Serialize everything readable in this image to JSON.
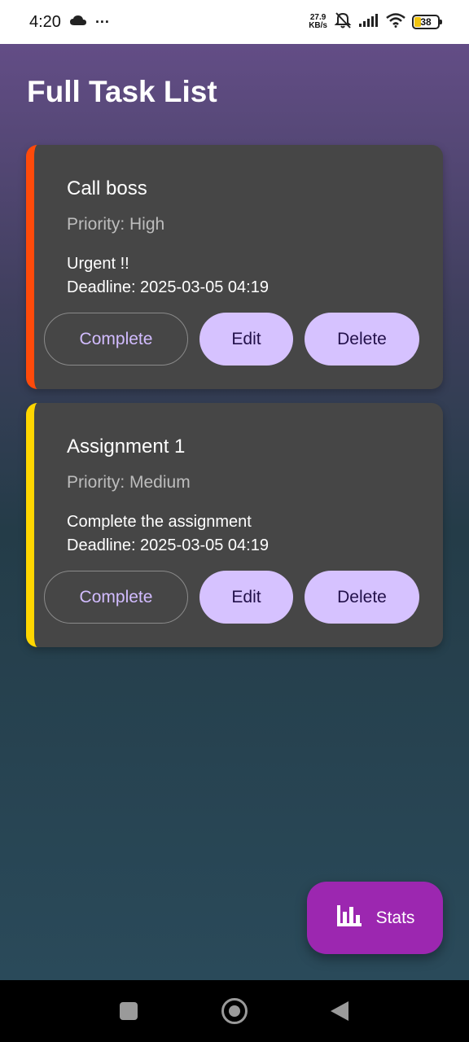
{
  "status_bar": {
    "time": "4:20",
    "dots": "···",
    "speed_value": "27.9",
    "speed_unit": "KB/s",
    "battery": "38"
  },
  "header": {
    "title": "Full Task List"
  },
  "tasks": [
    {
      "title": "Call boss",
      "priority": "Priority: High",
      "description": "Urgent !!",
      "deadline": "Deadline: 2025-03-05 04:19",
      "accent_color": "#ff4a0a",
      "complete_label": "Complete",
      "edit_label": "Edit",
      "delete_label": "Delete"
    },
    {
      "title": "Assignment 1",
      "priority": "Priority: Medium",
      "description": "Complete the assignment",
      "deadline": "Deadline: 2025-03-05 04:19",
      "accent_color": "#ffd600",
      "complete_label": "Complete",
      "edit_label": "Edit",
      "delete_label": "Delete"
    }
  ],
  "fab": {
    "label": "Stats",
    "icon": "bar-chart-icon",
    "color": "#9c27b0"
  },
  "colors": {
    "card_background": "#464646",
    "button_fill": "#d6c2ff",
    "button_outline_text": "#d2bcff"
  }
}
